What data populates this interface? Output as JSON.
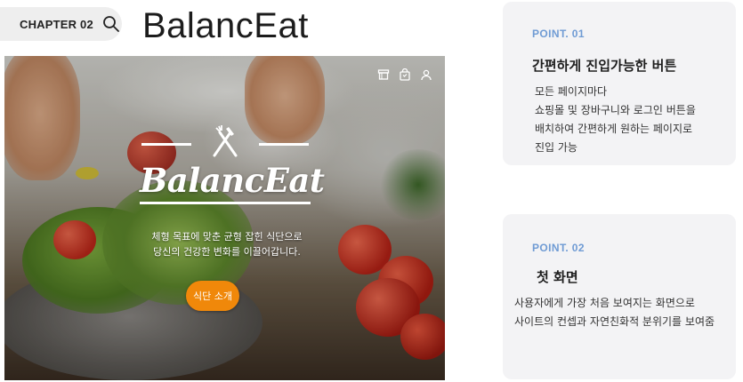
{
  "header": {
    "chapter_label": "CHAPTER 02",
    "search_icon": "search-icon",
    "brand_title": "BalancEat"
  },
  "hero": {
    "top_icons": [
      "store-icon",
      "shopping-bag-icon",
      "user-icon"
    ],
    "logo_text": "BalancEat",
    "logo_icon": "fork-knife-icon",
    "tagline_lines": [
      "체형 목표에 맞춘 균형 잡힌 식단으로",
      "당신의 건강한 변화를 이끌어갑니다."
    ],
    "cta_label": "식단 소개",
    "cta_color": "#f0880a"
  },
  "points": [
    {
      "label": "POINT. 01",
      "title": "간편하게 진입가능한 버튼",
      "desc_lines": [
        "모든 페이지마다",
        "쇼핑몰 및 장바구니와 로그인 버튼을",
        "배치하여 간편하게 원하는 페이지로",
        "진입 가능"
      ]
    },
    {
      "label": "POINT. 02",
      "title": "첫 화면",
      "desc_lines": [
        "사용자에게 가장 처음 보여지는 화면으로",
        "사이트의 컨셉과 자연친화적 분위기를 보여줌"
      ]
    }
  ],
  "colors": {
    "point_label": "#6f9bd4",
    "card_bg": "#f3f3f5",
    "cta": "#f0880a"
  }
}
